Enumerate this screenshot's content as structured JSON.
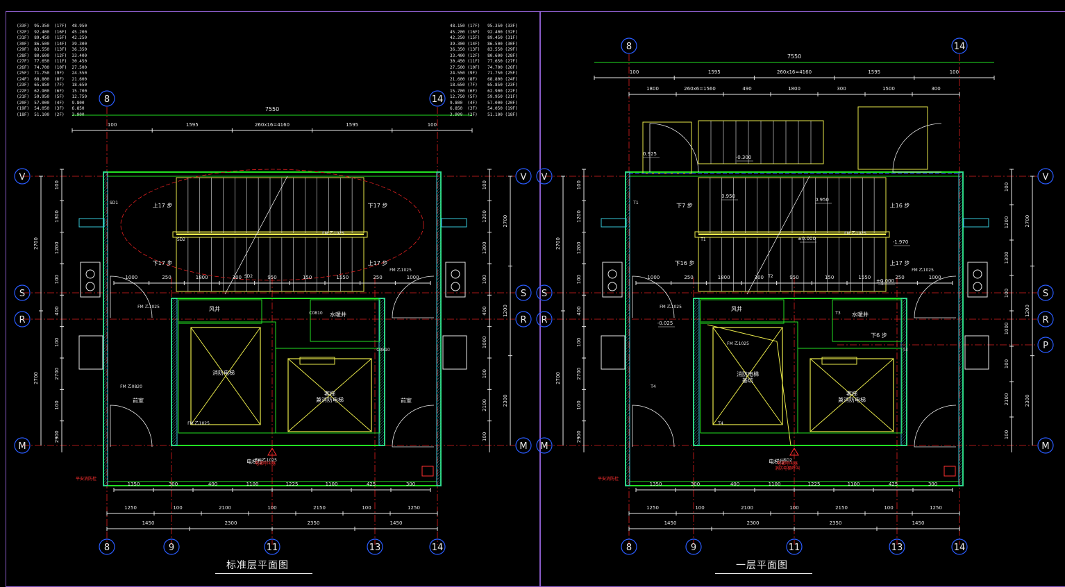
{
  "colors": {
    "background": "#000000",
    "wall": "#22e022",
    "axis": "#e02020",
    "dim": "#22e022",
    "stair": "#e8e84a",
    "text": "#e8e8e8",
    "grid_bubble": "#2a5cff",
    "hatch": "#36c8d8",
    "frame": "#8a5cc8",
    "red_text": "#ff3030"
  },
  "level_table_left": [
    [
      "(33F)",
      "95.350",
      "(17F)",
      "48.950"
    ],
    [
      "(32F)",
      "92.400",
      "(16F)",
      "45.200"
    ],
    [
      "(31F)",
      "89.450",
      "(15F)",
      "42.250"
    ],
    [
      "(30F)",
      "86.500",
      "(14F)",
      "39.300"
    ],
    [
      "(29F)",
      "83.550",
      "(13F)",
      "36.350"
    ],
    [
      "(28F)",
      "80.600",
      "(12F)",
      "33.400"
    ],
    [
      "(27F)",
      "77.650",
      "(11F)",
      "30.450"
    ],
    [
      "(26F)",
      "74.700",
      "(10F)",
      "27.500"
    ],
    [
      "(25F)",
      "71.750",
      "(9F)",
      "24.550"
    ],
    [
      "(24F)",
      "68.800",
      "(8F)",
      "21.600"
    ],
    [
      "(23F)",
      "65.850",
      "(7F)",
      "18.650"
    ],
    [
      "(22F)",
      "62.900",
      "(6F)",
      "15.700"
    ],
    [
      "(21F)",
      "59.950",
      "(5F)",
      "12.750"
    ],
    [
      "(20F)",
      "57.000",
      "(4F)",
      "9.800"
    ],
    [
      "(19F)",
      "54.050",
      "(3F)",
      "6.850"
    ],
    [
      "(18F)",
      "51.100",
      "(2F)",
      "3.900"
    ]
  ],
  "level_table_right": [
    [
      "48.150",
      "(17F)",
      "95.350",
      "(33F)"
    ],
    [
      "45.200",
      "(16F)",
      "92.400",
      "(32F)"
    ],
    [
      "42.250",
      "(15F)",
      "89.450",
      "(31F)"
    ],
    [
      "39.300",
      "(14F)",
      "86.500",
      "(30F)"
    ],
    [
      "36.350",
      "(13F)",
      "83.550",
      "(29F)"
    ],
    [
      "33.400",
      "(12F)",
      "80.600",
      "(28F)"
    ],
    [
      "30.450",
      "(11F)",
      "77.650",
      "(27F)"
    ],
    [
      "27.500",
      "(10F)",
      "74.700",
      "(26F)"
    ],
    [
      "24.550",
      "(9F)",
      "71.750",
      "(25F)"
    ],
    [
      "21.600",
      "(8F)",
      "68.800",
      "(24F)"
    ],
    [
      "18.650",
      "(7F)",
      "65.850",
      "(23F)"
    ],
    [
      "15.700",
      "(6F)",
      "62.900",
      "(22F)"
    ],
    [
      "12.750",
      "(5F)",
      "59.950",
      "(21F)"
    ],
    [
      "9.800",
      "(4F)",
      "57.000",
      "(20F)"
    ],
    [
      "6.850",
      "(3F)",
      "54.050",
      "(19F)"
    ],
    [
      "3.900",
      "(2F)",
      "51.100",
      "(18F)"
    ]
  ],
  "plans": [
    {
      "title": "标准层平面图",
      "overall_width": "7550",
      "top_dims_row1": [
        "100",
        "1595",
        "260x16=4160",
        "1595",
        "100"
      ],
      "top_dims_row2": [],
      "grid_top": [
        "8",
        "14"
      ],
      "grid_bottom": [
        "8",
        "9",
        "11",
        "13",
        "14"
      ],
      "grid_rows": [
        "V",
        "S",
        "R",
        "M"
      ],
      "grid_p": "",
      "bottom_dims_row1": [
        "1350",
        "300",
        "400",
        "1100",
        "1225",
        "1100",
        "425",
        "300"
      ],
      "bottom_dims_row2": [
        "1250",
        "100",
        "2100",
        "100",
        "2150",
        "100",
        "1250"
      ],
      "bottom_dims_row3": [
        "1450",
        "2300",
        "2350",
        "1450"
      ],
      "left_dims": [
        "100",
        "1300",
        "1200",
        "100",
        "400",
        "100",
        "2700",
        "100",
        "2900"
      ],
      "left_total": [
        "2700",
        "2700"
      ],
      "right_dims": [
        "100",
        "1200",
        "1300",
        "100",
        "400",
        "1000",
        "100",
        "2100",
        "100"
      ],
      "right_total": [
        "2700",
        "1200",
        "2300"
      ],
      "mid_dims": [
        "1000",
        "250",
        "1800",
        "300",
        "950",
        "150",
        "1550",
        "250",
        "1000"
      ],
      "rooms": [
        "风井",
        "水暖井",
        "前室",
        "前室",
        "消防电梯",
        "客梯\n兼消防电梯",
        "电梯厅"
      ],
      "stair_labels": [
        "上17 步",
        "下17 步",
        "下17 步",
        "上17 步"
      ],
      "tags": [
        "SD1",
        "SD2",
        "SD2",
        "C0810",
        "C0810",
        "FM 乙0820",
        "FM 乙1025",
        "FM 乙1025",
        "FM 乙1025",
        "FM 乙1025",
        "FM 乙1025"
      ],
      "red_labels": [
        "电梯呼叫器",
        "平安消防栓"
      ]
    },
    {
      "title": "一层平面图",
      "overall_width": "7550",
      "top_dims_row1": [
        "100",
        "1595",
        "260x16=4160",
        "1595",
        "100"
      ],
      "top_dims_row2": [
        "1800",
        "260x6=1560",
        "490",
        "1800",
        "300",
        "1500",
        "300"
      ],
      "grid_top": [
        "8",
        "14"
      ],
      "grid_bottom": [
        "8",
        "9",
        "11",
        "13",
        "14"
      ],
      "grid_rows": [
        "V",
        "S",
        "R",
        "M"
      ],
      "grid_p": "P",
      "bottom_dims_row1": [
        "1350",
        "300",
        "400",
        "1100",
        "1225",
        "1100",
        "425",
        "300"
      ],
      "bottom_dims_row2": [
        "1250",
        "100",
        "2100",
        "100",
        "2150",
        "100",
        "1250"
      ],
      "bottom_dims_row3": [
        "1450",
        "2300",
        "2350",
        "1450"
      ],
      "left_dims": [
        "100",
        "1200",
        "1200",
        "100",
        "400",
        "100",
        "2700",
        "100",
        "2900"
      ],
      "left_total": [
        "2700",
        "2700"
      ],
      "right_dims": [
        "100",
        "1200",
        "1300",
        "100",
        "1000",
        "100",
        "2100",
        "100"
      ],
      "right_total": [
        "2700",
        "1200",
        "2300"
      ],
      "mid_dims": [
        "1000",
        "250",
        "1800",
        "300",
        "950",
        "150",
        "1550",
        "250",
        "1000"
      ],
      "rooms": [
        "风井",
        "水暖井",
        "消防电梯\n基坑",
        "客梯\n兼消防电梯",
        "电梯厅"
      ],
      "stair_labels": [
        "下7 步",
        "上16 步",
        "下16 步",
        "上17 步",
        "下6 步"
      ],
      "tags": [
        "T1",
        "T1",
        "T2",
        "T3",
        "T3",
        "T4",
        "T4",
        "SD2",
        "FM 乙1025",
        "FM 乙1025",
        "FM 乙1025",
        "FM 乙1025"
      ],
      "levels": [
        "0.925",
        "0.950",
        "±0.000",
        "±0.000",
        "-0.025",
        "-0.300",
        "0.950",
        "-1.970"
      ],
      "red_labels": [
        "电梯呼叫器\n消防电梯呼叫",
        "平安消防栓"
      ]
    }
  ]
}
